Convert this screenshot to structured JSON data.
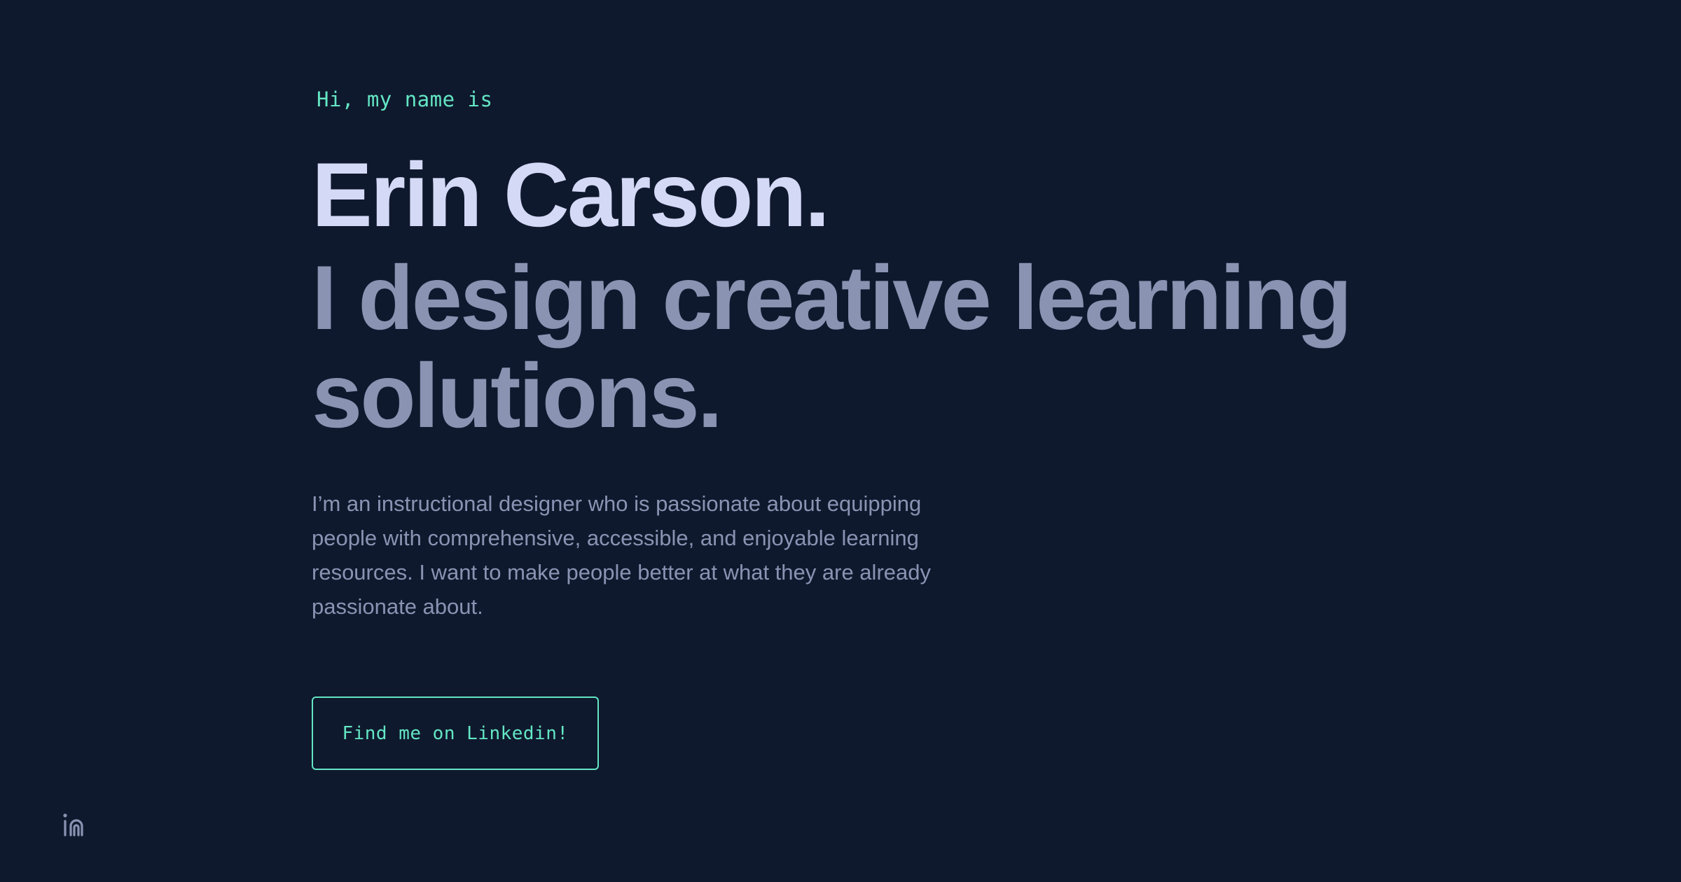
{
  "hero": {
    "greeting": "Hi, my name is",
    "name": "Erin Carson.",
    "tagline": "I design creative learning solutions.",
    "bio": "I’m an instructional designer who is passionate about equipping people with comprehensive, accessible, and enjoyable learning resources. I want to make people better at what they are already passionate about.",
    "cta_label": "Find me on Linkedin!"
  },
  "social": {
    "linkedin_icon": "linkedin-icon"
  },
  "colors": {
    "background": "#0f192d",
    "accent": "#63e6c4",
    "heading": "#d4d9f6",
    "muted": "#8b93b3"
  }
}
